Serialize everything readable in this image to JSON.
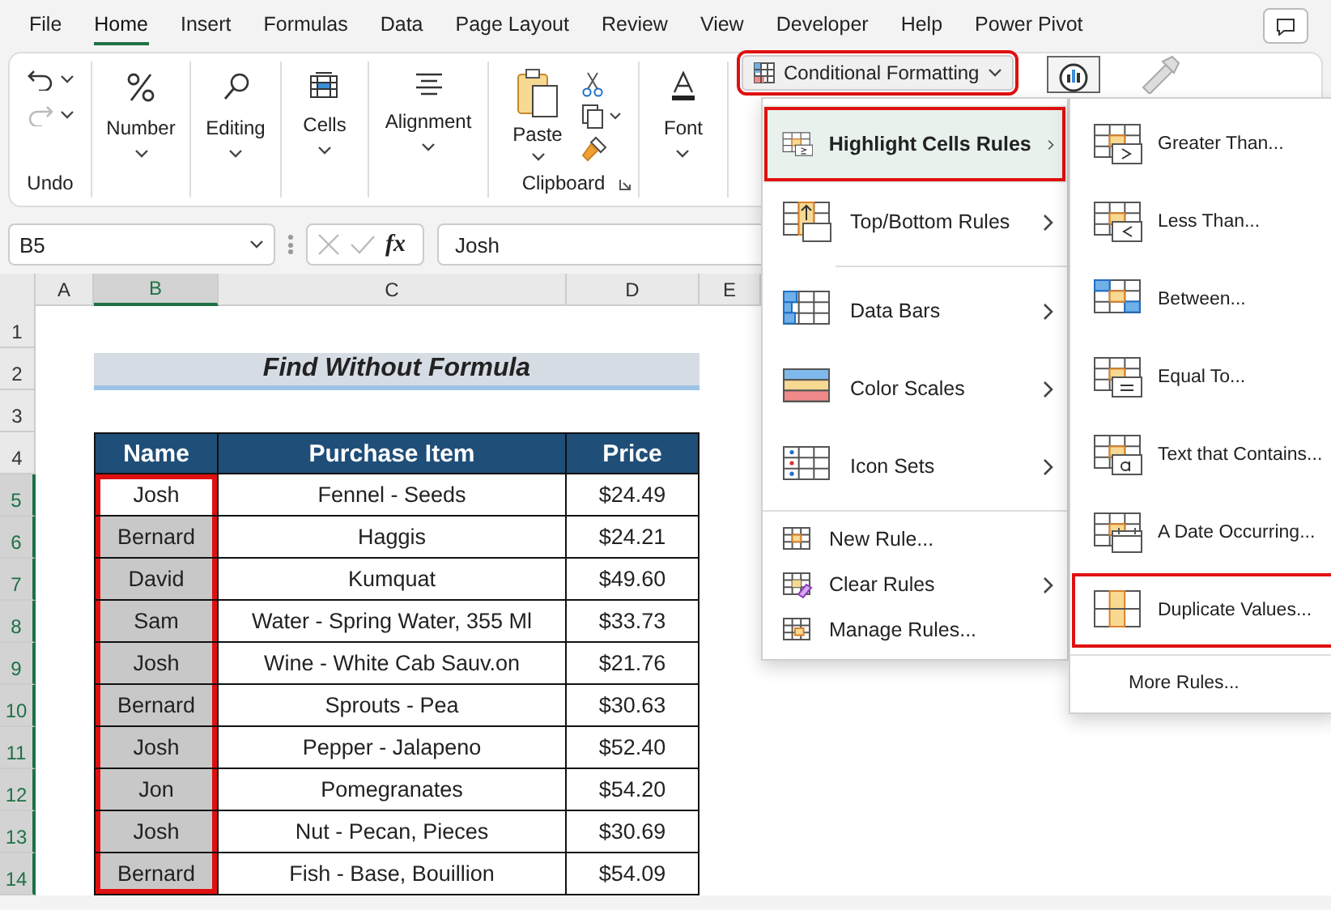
{
  "tabs": [
    {
      "label": "File",
      "selected": false
    },
    {
      "label": "Home",
      "selected": true
    },
    {
      "label": "Insert",
      "selected": false
    },
    {
      "label": "Formulas",
      "selected": false
    },
    {
      "label": "Data",
      "selected": false
    },
    {
      "label": "Page Layout",
      "selected": false
    },
    {
      "label": "Review",
      "selected": false
    },
    {
      "label": "View",
      "selected": false
    },
    {
      "label": "Developer",
      "selected": false
    },
    {
      "label": "Help",
      "selected": false
    },
    {
      "label": "Power Pivot",
      "selected": false
    }
  ],
  "ribbon": {
    "groups": [
      {
        "kind": "undo",
        "label": "Undo",
        "redo_disabled": true
      },
      {
        "kind": "dropdown",
        "label": "Number"
      },
      {
        "kind": "dropdown",
        "label": "Editing"
      },
      {
        "kind": "dropdown",
        "label": "Cells"
      },
      {
        "kind": "dropdown",
        "label": "Alignment"
      },
      {
        "kind": "clipboard",
        "label": "Paste",
        "group_label": "Clipboard"
      },
      {
        "kind": "dropdown",
        "label": "Font"
      }
    ],
    "conditional_formatting": {
      "label": "Conditional Formatting",
      "outlined": true
    }
  },
  "formula_bar": {
    "name_box": "B5",
    "fx": "fx",
    "value": "Josh"
  },
  "sheet": {
    "columns": [
      {
        "label": "A",
        "selected": false
      },
      {
        "label": "B",
        "selected": true
      },
      {
        "label": "C",
        "selected": false
      },
      {
        "label": "D",
        "selected": false
      },
      {
        "label": "E",
        "selected": false
      }
    ],
    "row_numbers": [
      {
        "label": "1",
        "selected": false
      },
      {
        "label": "2",
        "selected": false
      },
      {
        "label": "3",
        "selected": false
      },
      {
        "label": "4",
        "selected": false
      },
      {
        "label": "5",
        "selected": true
      },
      {
        "label": "6",
        "selected": true
      },
      {
        "label": "7",
        "selected": true
      },
      {
        "label": "8",
        "selected": true
      },
      {
        "label": "9",
        "selected": true
      },
      {
        "label": "10",
        "selected": true
      },
      {
        "label": "11",
        "selected": true
      },
      {
        "label": "12",
        "selected": true
      },
      {
        "label": "13",
        "selected": true
      },
      {
        "label": "14",
        "selected": true
      }
    ],
    "title": "Find Without Formula",
    "table": {
      "columns": [
        "Name",
        "Purchase Item",
        "Price"
      ],
      "name_range_outlined": true,
      "rows": [
        {
          "name": "Josh",
          "item": "Fennel - Seeds",
          "price": "$24.49",
          "active": true
        },
        {
          "name": "Bernard",
          "item": "Haggis",
          "price": "$24.21",
          "active": false
        },
        {
          "name": "David",
          "item": "Kumquat",
          "price": "$49.60",
          "active": false
        },
        {
          "name": "Sam",
          "item": "Water - Spring Water, 355 Ml",
          "price": "$33.73",
          "active": false
        },
        {
          "name": "Josh",
          "item": "Wine - White Cab Sauv.on",
          "price": "$21.76",
          "active": false
        },
        {
          "name": "Bernard",
          "item": "Sprouts - Pea",
          "price": "$30.63",
          "active": false
        },
        {
          "name": "Josh",
          "item": "Pepper - Jalapeno",
          "price": "$52.40",
          "active": false
        },
        {
          "name": "Jon",
          "item": "Pomegranates",
          "price": "$54.20",
          "active": false
        },
        {
          "name": "Josh",
          "item": "Nut - Pecan, Pieces",
          "price": "$30.69",
          "active": false
        },
        {
          "name": "Bernard",
          "item": "Fish - Base, Bouillion",
          "price": "$54.09",
          "active": false
        }
      ]
    }
  },
  "menu": {
    "groups": [
      {
        "items": [
          {
            "kind": "big",
            "label": "Highlight Cells Rules",
            "submenu": true,
            "selected": true,
            "outlined": true
          },
          {
            "kind": "big",
            "label": "Top/Bottom Rules",
            "submenu": true,
            "selected": false,
            "outlined": false
          }
        ]
      },
      {
        "items": [
          {
            "kind": "big",
            "label": "Data Bars",
            "submenu": true,
            "selected": false,
            "outlined": false
          },
          {
            "kind": "big",
            "label": "Color Scales",
            "submenu": true,
            "selected": false,
            "outlined": false
          },
          {
            "kind": "big",
            "label": "Icon Sets",
            "submenu": true,
            "selected": false,
            "outlined": false
          }
        ]
      },
      {
        "items": [
          {
            "kind": "small",
            "label": "New Rule...",
            "submenu": false,
            "selected": false,
            "outlined": false
          },
          {
            "kind": "small",
            "label": "Clear Rules",
            "submenu": true,
            "selected": false,
            "outlined": false
          },
          {
            "kind": "small",
            "label": "Manage Rules...",
            "submenu": false,
            "selected": false,
            "outlined": false
          }
        ]
      }
    ]
  },
  "submenu": {
    "groups": [
      {
        "items": [
          {
            "kind": "big",
            "label": "Greater Than...",
            "outlined": false
          },
          {
            "kind": "big",
            "label": "Less Than...",
            "outlined": false
          },
          {
            "kind": "big",
            "label": "Between...",
            "outlined": false
          },
          {
            "kind": "big",
            "label": "Equal To...",
            "outlined": false
          },
          {
            "kind": "big",
            "label": "Text that Contains...",
            "outlined": false
          },
          {
            "kind": "big",
            "label": "A Date Occurring...",
            "outlined": false
          },
          {
            "kind": "big",
            "label": "Duplicate Values...",
            "outlined": true
          }
        ]
      },
      {
        "items": [
          {
            "kind": "small",
            "label": "More Rules...",
            "outlined": false
          }
        ]
      }
    ]
  }
}
